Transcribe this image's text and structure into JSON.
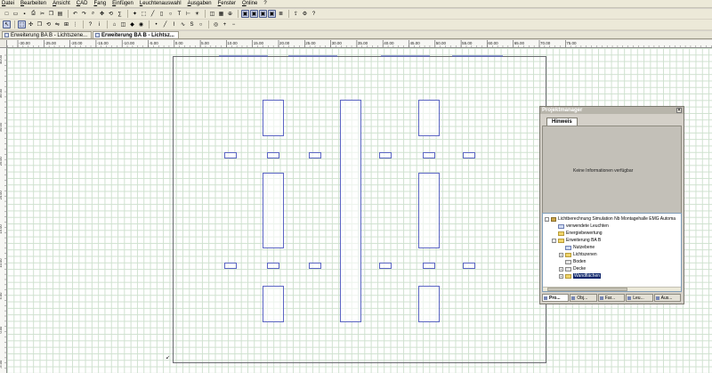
{
  "menu": [
    "Datei",
    "Bearbeiten",
    "Ansicht",
    "CAD",
    "Fang",
    "Einfügen",
    "Leuchtenauswahl",
    "Ausgaben",
    "Fenster",
    "Online",
    "?"
  ],
  "toolbar1_icons": [
    "new-icon",
    "open-icon",
    "save-icon",
    "print-icon",
    "cut-icon",
    "copy-icon",
    "paste-icon",
    "undo-icon",
    "redo-icon",
    "zoom-icon",
    "pan-icon",
    "rotate-icon",
    "calc-icon",
    "wizard-icon",
    "select-icon",
    "line-icon",
    "rect-icon",
    "circle-icon",
    "text-icon",
    "measure-icon",
    "light-icon",
    "luminaire-icon",
    "grid-icon",
    "snap-icon",
    "view1-icon",
    "view2-icon",
    "view3-icon",
    "view4-icon",
    "layer-icon",
    "export-icon",
    "settings-icon",
    "help-icon"
  ],
  "toolbar2_icons": [
    "pointer-icon",
    "select-icon",
    "move-icon",
    "copy-icon",
    "rotate-icon",
    "mirror-icon",
    "align-icon",
    "array-icon",
    "help-icon",
    "info-icon",
    "insert-room-icon",
    "insert-luminaire-icon",
    "insert-object-icon",
    "camera-icon",
    "calc-point-icon",
    "line-icon",
    "polyline-icon",
    "curve-icon",
    "spline-icon",
    "circle-icon",
    "bulb-icon",
    "zoom-in-icon",
    "zoom-out-icon"
  ],
  "doc_tabs": [
    {
      "label": "Erweiterung BA B - Lichtszene...",
      "active": false
    },
    {
      "label": "Erweiterung BA B - Lichtsz...",
      "active": true
    }
  ],
  "ruler_h_labels": [
    "-30.00",
    "-25.00",
    "-20.00",
    "-15.00",
    "-10.00",
    "-5.00",
    "0.00",
    "5.00",
    "10.00",
    "15.00",
    "20.00",
    "25.00",
    "30.00",
    "35.00",
    "40.00",
    "45.00",
    "50.00",
    "55.00",
    "60.00",
    "65.00",
    "70.00",
    "75.00"
  ],
  "ruler_v_labels": [
    "40.00",
    "35.00",
    "30.00",
    "25.00",
    "20.00",
    "15.00",
    "10.00",
    "5.00",
    "0.00",
    "-5.00"
  ],
  "project_manager": {
    "title": "Projektmanager",
    "hint_tab": "Hinweis",
    "hint_text": "Keine Informationen verfügbar",
    "tree": [
      {
        "label": "Lichtberechnung Simulation Nb Montagehalle EMG Automa",
        "indent": 0,
        "expander": "-",
        "icon": "project"
      },
      {
        "label": "verwendete Leuchten",
        "indent": 1,
        "expander": "",
        "icon": "lamp"
      },
      {
        "label": "Energiebewertung",
        "indent": 1,
        "expander": "",
        "icon": "folder"
      },
      {
        "label": "Erweiterung BA B",
        "indent": 1,
        "expander": "-",
        "icon": "folder"
      },
      {
        "label": "Nutzebene",
        "indent": 2,
        "expander": "",
        "icon": "plane"
      },
      {
        "label": "Lichtszenen",
        "indent": 2,
        "expander": "+",
        "icon": "folder"
      },
      {
        "label": "Boden",
        "indent": 2,
        "expander": "",
        "icon": "surface"
      },
      {
        "label": "Decke",
        "indent": 2,
        "expander": "+",
        "icon": "surface"
      },
      {
        "label": "Wandflächen",
        "indent": 2,
        "expander": "+",
        "icon": "folder",
        "selected": true
      }
    ],
    "tabs": [
      "Pro...",
      "Obj...",
      "Far...",
      "Leu...",
      "Aus..."
    ]
  },
  "colors": {
    "grid": "#cfe1cf",
    "luminaire": "#5c66c4",
    "room": "#6a6a70",
    "selection": "#0a246a"
  }
}
